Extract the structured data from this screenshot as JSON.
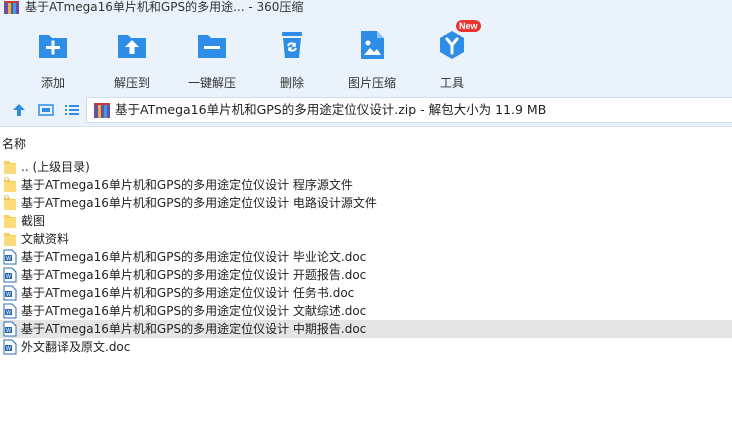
{
  "window": {
    "title": "基于ATmega16单片机和GPS的多用途... - 360压缩"
  },
  "toolbar": {
    "items": [
      {
        "label": "添加",
        "icon": "add-icon"
      },
      {
        "label": "解压到",
        "icon": "extract-to-icon"
      },
      {
        "label": "一键解压",
        "icon": "one-click-extract-icon"
      },
      {
        "label": "删除",
        "icon": "delete-icon"
      },
      {
        "label": "图片压缩",
        "icon": "image-compress-icon"
      },
      {
        "label": "工具",
        "icon": "tools-icon",
        "badge": "New"
      }
    ]
  },
  "address": {
    "path": "基于ATmega16单片机和GPS的多用途定位仪设计.zip - 解包大小为 11.9 MB"
  },
  "list": {
    "column_name": "名称",
    "rows": [
      {
        "name": ".. (上级目录)",
        "type": "parent-folder"
      },
      {
        "name": "基于ATmega16单片机和GPS的多用途定位仪设计 程序源文件",
        "type": "folder"
      },
      {
        "name": "基于ATmega16单片机和GPS的多用途定位仪设计 电路设计源文件",
        "type": "folder"
      },
      {
        "name": "截图",
        "type": "folder"
      },
      {
        "name": "文献资料",
        "type": "folder"
      },
      {
        "name": "基于ATmega16单片机和GPS的多用途定位仪设计 毕业论文.doc",
        "type": "doc"
      },
      {
        "name": "基于ATmega16单片机和GPS的多用途定位仪设计 开题报告.doc",
        "type": "doc"
      },
      {
        "name": "基于ATmega16单片机和GPS的多用途定位仪设计 任务书.doc",
        "type": "doc"
      },
      {
        "name": "基于ATmega16单片机和GPS的多用途定位仪设计 文献综述.doc",
        "type": "doc"
      },
      {
        "name": "基于ATmega16单片机和GPS的多用途定位仪设计 中期报告.doc",
        "type": "doc",
        "selected": true
      },
      {
        "name": "外文翻译及原文.doc",
        "type": "doc"
      }
    ]
  },
  "colors": {
    "toolbar_bg": "#eaf3fb",
    "accent_blue": "#2e8de6",
    "folder_yellow": "#f6cf57",
    "selected_row": "#e5e5e5",
    "badge_red": "#e8332f"
  }
}
